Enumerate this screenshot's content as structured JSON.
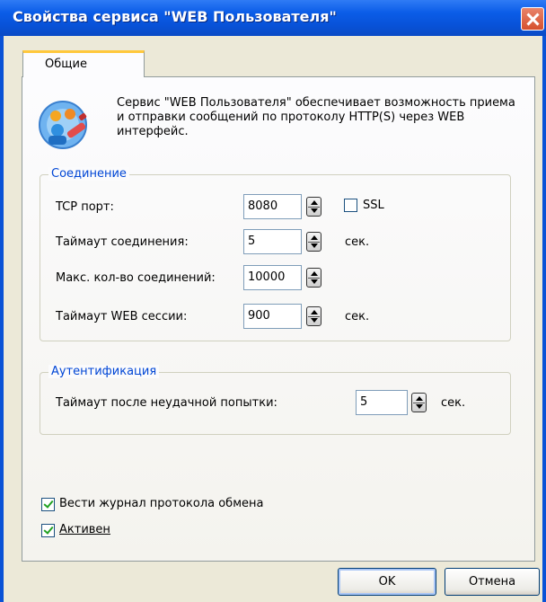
{
  "window": {
    "title": "Свойства сервиса \"WEB Пользователя\"",
    "close_icon": "close-icon"
  },
  "tabs": [
    {
      "label": "Общие",
      "active": true
    }
  ],
  "description": "Сервис \"WEB Пользователя\" обеспечивает возможность приема и отправки сообщений по протоколу HTTP(S) через WEB интерфейс.",
  "connection": {
    "legend": "Соединение",
    "tcp_port": {
      "label": "TCP порт:",
      "value": "8080"
    },
    "ssl": {
      "label": "SSL",
      "checked": false
    },
    "timeout": {
      "label": "Таймаут соединения:",
      "value": "5",
      "unit": "сек."
    },
    "max_conn": {
      "label": "Макс. кол-во соединений:",
      "value": "10000"
    },
    "web_session": {
      "label": "Таймаут WEB сессии:",
      "value": "900",
      "unit": "сек."
    }
  },
  "auth": {
    "legend": "Аутентификация",
    "fail_timeout": {
      "label": "Таймаут после неудачной попытки:",
      "value": "5",
      "unit": "сек."
    }
  },
  "options": {
    "log": {
      "label": "Вести журнал протокола обмена",
      "checked": true
    },
    "active": {
      "label": "Активен",
      "checked": true
    }
  },
  "buttons": {
    "ok": "OK",
    "cancel": "Отмена"
  },
  "colors": {
    "title_bar": "#0a52d6",
    "dialog_bg": "#ece9d8",
    "group_legend": "#0046d5"
  }
}
